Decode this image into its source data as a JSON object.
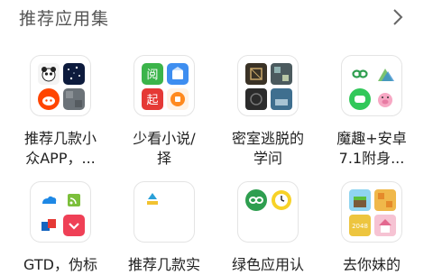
{
  "header": {
    "title": "推荐应用集"
  },
  "collections": [
    {
      "line1": "推荐几款小",
      "line2": "众APP，...",
      "icons": [
        "panda-app-icon",
        "starry-sky-icon",
        "reddit-app-icon",
        "gray-texture-icon"
      ]
    },
    {
      "line1": "少看小说/",
      "line2": "择",
      "icons": [
        "green-reader-icon",
        "blue-doc-icon",
        "red-qi-icon",
        "orange-app-icon"
      ]
    },
    {
      "line1": "密室逃脱的",
      "line2": "学问",
      "icons": [
        "escape-room-icon",
        "puzzle-game-icon",
        "dark-room-icon",
        "blue-room-icon"
      ]
    },
    {
      "line1": "魔趣+安卓",
      "line2": "7.1附身...",
      "icons": [
        "green-infinity-icon",
        "green-triangles-icon",
        "green-chat-icon",
        "pink-pig-icon"
      ]
    },
    {
      "line1": "GTD，伪标",
      "line2": "",
      "icons": [
        "cloud-app-icon",
        "rss-reader-icon",
        "red-blue-app-icon",
        "pocket-app-icon"
      ]
    },
    {
      "line1": "推荐几款实",
      "line2": "",
      "icons": [
        "blue-upload-icon"
      ]
    },
    {
      "line1": "绿色应用认",
      "line2": "",
      "icons": [
        "green-infinity-icon",
        "yellow-clock-icon"
      ]
    },
    {
      "line1": "去你妹的",
      "line2": "",
      "icons": [
        "block-game-icon",
        "puzzle-board-icon",
        "number-2048-icon",
        "pink-house-icon"
      ]
    }
  ]
}
